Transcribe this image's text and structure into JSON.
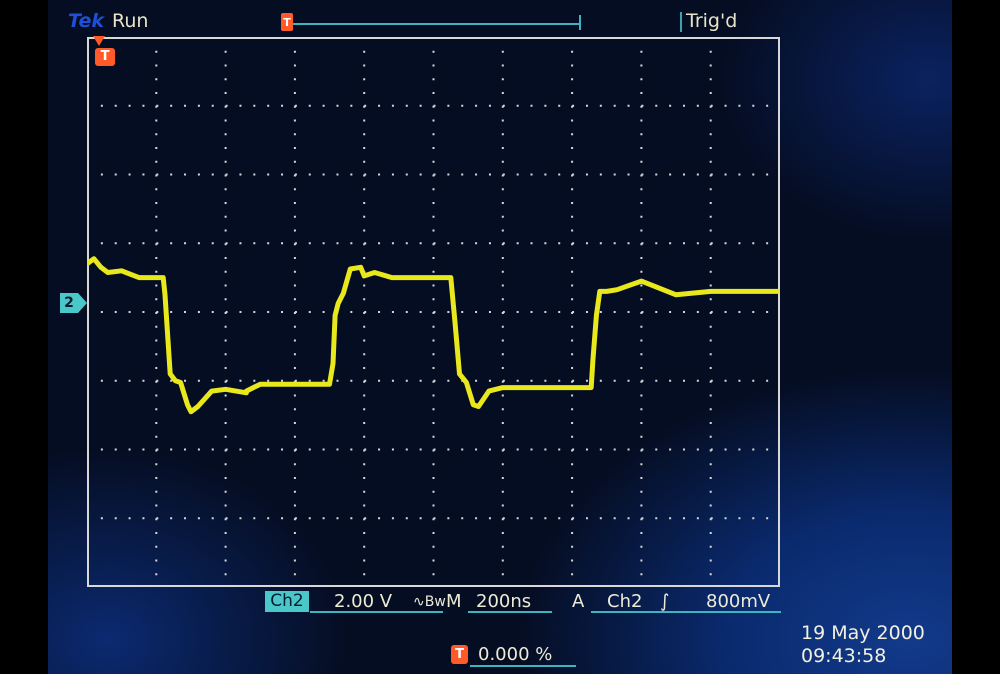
{
  "header": {
    "brand": "Tek",
    "acquisition_status": "Run",
    "trigger_status": "Trig'd",
    "record_trigger_marker": "T"
  },
  "markers": {
    "trigger_position": "T",
    "channel_ground": "2"
  },
  "readouts": {
    "channel": "Ch2",
    "volts_per_div": "2.00 V",
    "bandwidth_symbol": "∿Bw",
    "timebase_prefix": "M",
    "time_per_div": "200ns",
    "trigger_mode": "A",
    "trigger_source": "Ch2",
    "trigger_slope_symbol": "∫",
    "trigger_level": "800mV",
    "trigger_position_marker": "T",
    "trigger_position_pct": "0.000 %"
  },
  "datetime": {
    "date": "19 May 2000",
    "time": "09:43:58"
  },
  "colors": {
    "trace": "#e8e81c",
    "graticule": "#d8d8d8",
    "accent": "#3fb4bf",
    "trigger_marker": "#ff5a28",
    "channel_marker": "#49c7c9",
    "brand": "#1f4fd8"
  },
  "chart_data": {
    "type": "line",
    "grid": true,
    "divisions": {
      "x": 10,
      "y": 8
    },
    "units": {
      "x": "ns",
      "y": "V"
    },
    "xlim": [
      0,
      2000
    ],
    "ylim": [
      -8,
      8
    ],
    "series": [
      {
        "x": [
          0,
          20,
          40,
          60,
          100,
          150,
          205,
          220,
          225,
          240,
          255,
          270,
          290,
          300,
          320,
          360,
          400,
          460,
          460,
          480,
          500,
          525,
          550,
          600,
          650,
          700,
          710,
          716,
          725,
          740,
          760,
          790,
          800,
          830,
          880,
          950,
          1000,
          1040,
          1050,
          1062,
          1075,
          1095,
          1115,
          1130,
          1160,
          1200,
          1280,
          1400,
          1455,
          1460,
          1470,
          1480,
          1500,
          1530,
          1600,
          1700,
          1800,
          1900,
          1932,
          1940,
          1950,
          1960,
          1980,
          2000
        ],
        "y": [
          1.4,
          1.55,
          1.3,
          1.15,
          1.2,
          1.0,
          1.0,
          1.0,
          0.5,
          -1.8,
          -2.0,
          -2.05,
          -2.7,
          -2.9,
          -2.75,
          -2.3,
          -2.25,
          -2.35,
          -2.3,
          -2.2,
          -2.1,
          -2.1,
          -2.1,
          -2.1,
          -2.1,
          -2.1,
          -1.5,
          -0.1,
          0.25,
          0.55,
          1.25,
          1.3,
          1.05,
          1.15,
          1.0,
          1.0,
          1.0,
          1.0,
          1.0,
          -0.3,
          -1.8,
          -2.05,
          -2.7,
          -2.75,
          -2.3,
          -2.2,
          -2.2,
          -2.2,
          -2.2,
          -1.4,
          -0.1,
          0.6,
          0.6,
          0.65,
          0.9,
          0.5,
          0.6,
          0.6,
          0.6,
          0.6,
          0.6,
          0.6,
          0.6,
          0.6
        ]
      }
    ]
  }
}
